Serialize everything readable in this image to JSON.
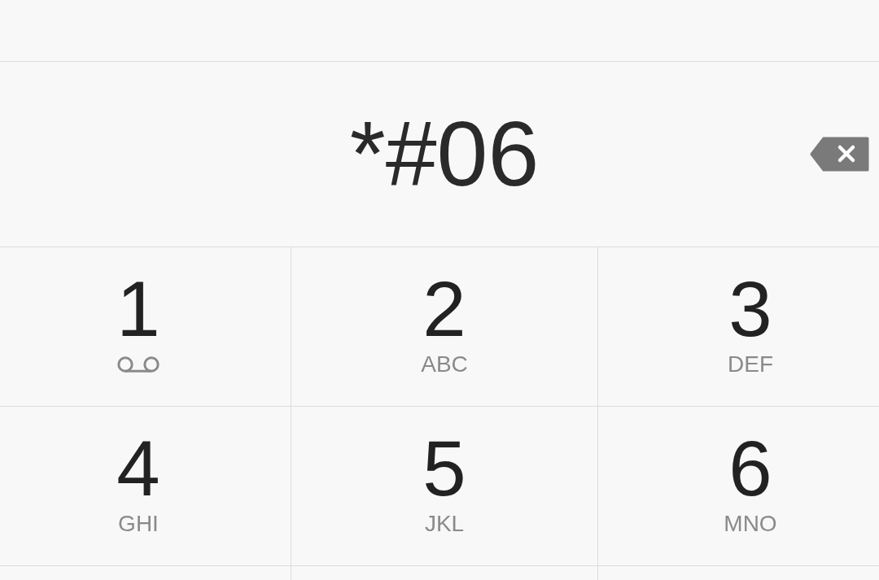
{
  "dialer": {
    "number": "*#06",
    "keys": [
      {
        "digit": "1",
        "kind": "voicemail"
      },
      {
        "digit": "2",
        "kind": "letters",
        "letters": "ABC"
      },
      {
        "digit": "3",
        "kind": "letters",
        "letters": "DEF"
      },
      {
        "digit": "4",
        "kind": "letters",
        "letters": "GHI"
      },
      {
        "digit": "5",
        "kind": "letters",
        "letters": "JKL"
      },
      {
        "digit": "6",
        "kind": "letters",
        "letters": "MNO"
      }
    ]
  }
}
